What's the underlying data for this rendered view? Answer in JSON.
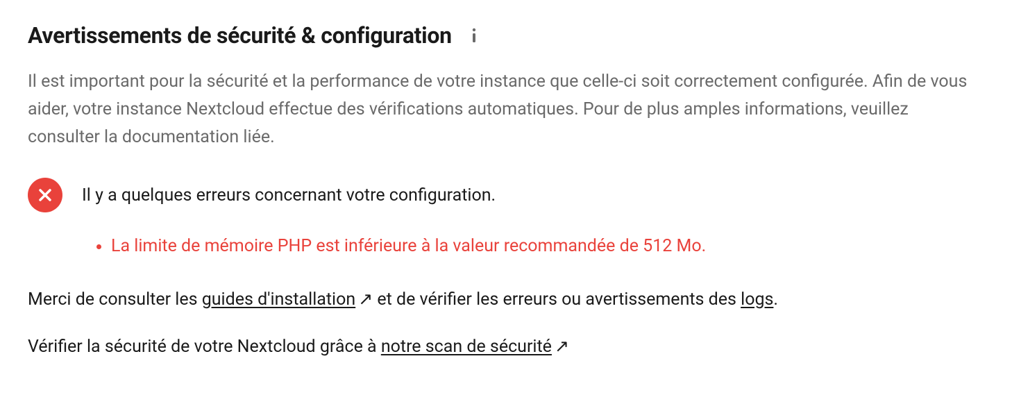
{
  "header": {
    "title": "Avertissements de sécurité & configuration"
  },
  "intro": "Il est important pour la sécurité et la performance de votre instance que celle-ci soit correctement configurée. Afin de vous aider, votre instance Nextcloud effectue des vérifications automatiques. Pour de plus amples informations, veuillez consulter la documentation liée.",
  "alert": {
    "summary": "Il y a quelques erreurs concernant votre configuration.",
    "issues": [
      "La limite de mémoire PHP est inférieure à la valeur recommandée de 512 Mo."
    ]
  },
  "footer": {
    "line1_pre": "Merci de consulter les ",
    "line1_link1": "guides d'installation",
    "line1_mid": " et de vérifier les erreurs ou avertissements des ",
    "line1_link2": "logs",
    "line1_post": ".",
    "line2_pre": "Vérifier la sécurité de votre Nextcloud grâce à ",
    "line2_link": "notre scan de sécurité",
    "ext_arrow": "↗"
  },
  "colors": {
    "error": "#e9423b",
    "muted": "#6a6a6a"
  }
}
